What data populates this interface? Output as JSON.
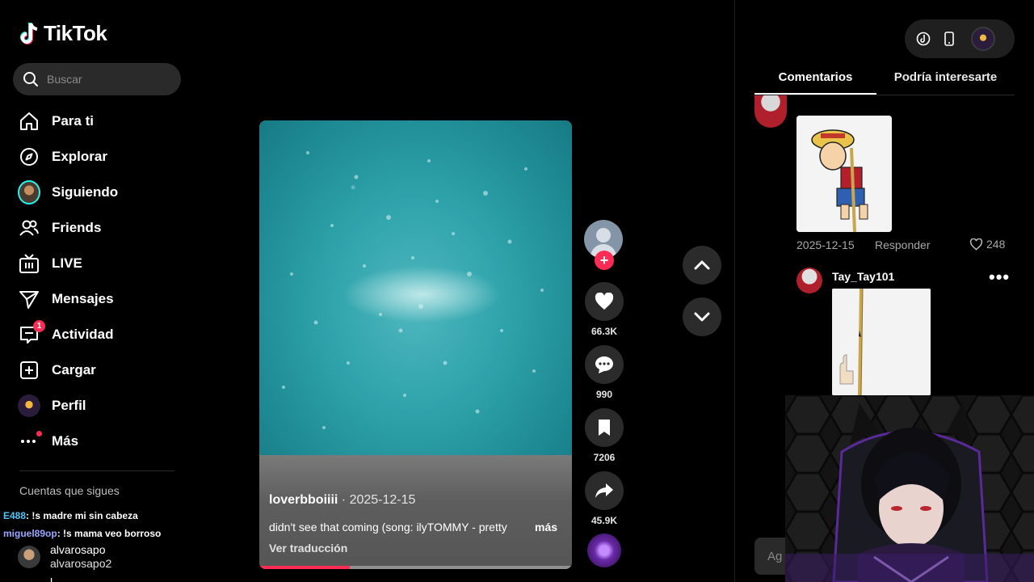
{
  "app": {
    "name": "TikTok"
  },
  "search": {
    "placeholder": "Buscar"
  },
  "sidebar": {
    "items": [
      {
        "label": "Para ti",
        "icon": "home-icon"
      },
      {
        "label": "Explorar",
        "icon": "compass-icon"
      },
      {
        "label": "Siguiendo",
        "icon": "avatar"
      },
      {
        "label": "Friends",
        "icon": "friends-icon"
      },
      {
        "label": "LIVE",
        "icon": "live-icon"
      },
      {
        "label": "Mensajes",
        "icon": "send-icon"
      },
      {
        "label": "Actividad",
        "icon": "inbox-icon",
        "badge": "1"
      },
      {
        "label": "Cargar",
        "icon": "plus-square-icon"
      },
      {
        "label": "Perfil",
        "icon": "avatar"
      },
      {
        "label": "Más",
        "icon": "more-icon"
      }
    ],
    "following_title": "Cuentas que sigues",
    "accounts": [
      {
        "name": "alvarosapo",
        "handle": "alvarosapo2"
      }
    ],
    "account_cut": "l"
  },
  "chat_overlay": [
    {
      "user": "E488",
      "text": ": !s madre mi sin cabeza"
    },
    {
      "user": "miguel89op",
      "text": ": !s mama veo borroso"
    }
  ],
  "video": {
    "author": "loverbboiiii",
    "date": " · 2025-12-15",
    "description": "didn't see that coming (song: ilyTOMMY - pretty",
    "more": "más",
    "translate": "Ver traducción",
    "progress": 0.29
  },
  "actions": {
    "likes": "66.3K",
    "comments": "990",
    "saves": "7206",
    "shares": "45.9K"
  },
  "panel": {
    "tabs": [
      "Comentarios",
      "Podría interesarte"
    ],
    "comments": [
      {
        "date": "2025-12-15",
        "reply": "Responder",
        "likes": "248"
      },
      {
        "user": "Tay_Tay101"
      }
    ],
    "input_placeholder": "Ag"
  },
  "colors": {
    "accent": "#fe2c55",
    "cyan": "#25f4ee",
    "background": "#000000",
    "button_bg": "#2b2b2b"
  }
}
